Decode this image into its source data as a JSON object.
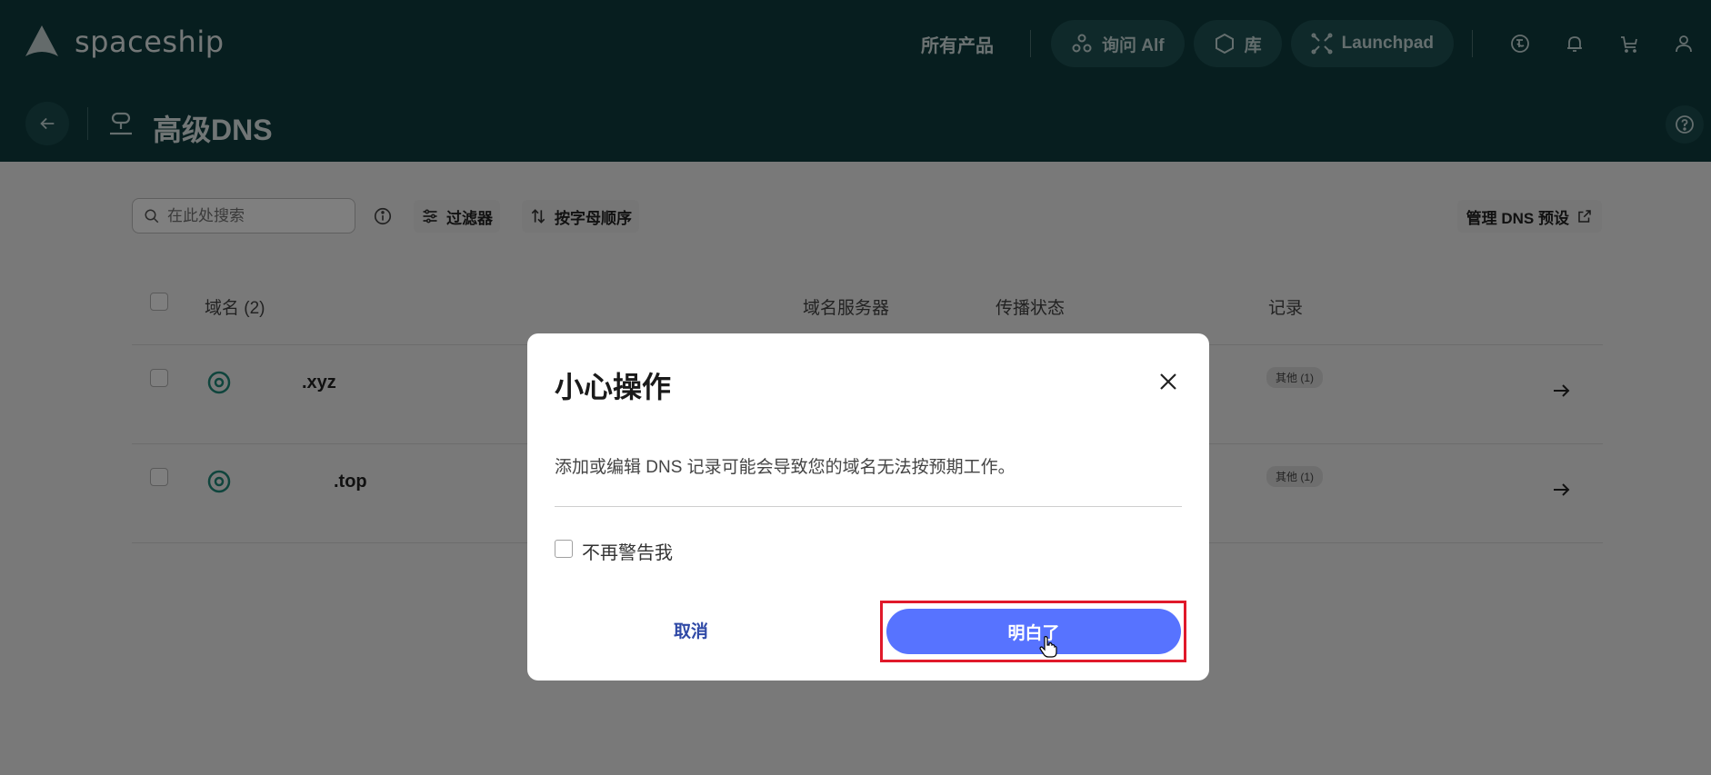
{
  "header": {
    "brand": "spaceship",
    "nav_products": "所有产品",
    "pills": [
      {
        "label": "询问 Alf",
        "icon": "alf-icon"
      },
      {
        "label": "库",
        "icon": "hexagon-icon"
      },
      {
        "label": "Launchpad",
        "icon": "launchpad-icon"
      }
    ],
    "icons": [
      "language-icon",
      "bell-icon",
      "cart-icon",
      "user-icon"
    ]
  },
  "subheader": {
    "title": "高级DNS"
  },
  "toolbar": {
    "search_placeholder": "在此处搜索",
    "filter_label": "过滤器",
    "sort_label": "按字母顺序",
    "manage_label": "管理 DNS 预设"
  },
  "table": {
    "columns": {
      "domain": "域名 (2)",
      "nameservers": "域名服务器",
      "propagation": "传播状态",
      "records": "记录"
    },
    "rows": [
      {
        "domain_suffix": ".xyz",
        "records_badge": "其他 (1)"
      },
      {
        "domain_suffix": ".top",
        "records_badge": "其他 (1)"
      }
    ]
  },
  "dialog": {
    "title": "小心操作",
    "message": "添加或编辑 DNS 记录可能会导致您的域名无法按预期工作。",
    "checkbox_label": "不再警告我",
    "checkbox_checked": false,
    "cancel_label": "取消",
    "confirm_label": "明白了"
  },
  "colors": {
    "header_bg": "#0f3d3e",
    "primary_button": "#5773ff",
    "highlight_border": "#e0192a"
  }
}
